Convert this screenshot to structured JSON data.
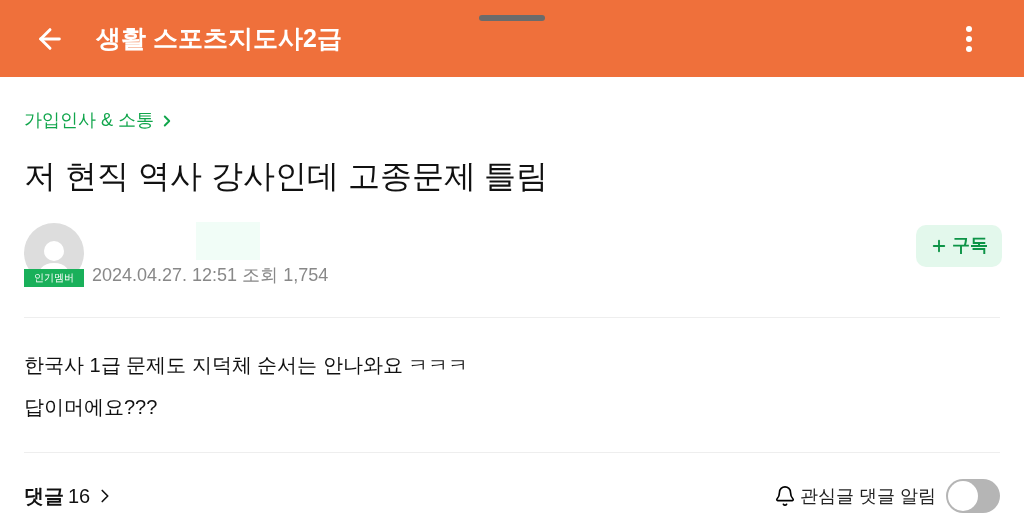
{
  "header": {
    "title": "생활 스포츠지도사2급"
  },
  "post": {
    "board": "가입인사 & 소통",
    "title": "저 현직 역사 강사인데 고종문제 틀림",
    "author": {
      "badge": "인기멤버",
      "meta": "2024.04.27. 12:51 조회 1,754"
    },
    "subscribe": {
      "label": "구독"
    },
    "body": [
      "한국사 1급 문제도 지덕체 순서는 안나와요 ㅋㅋㅋ",
      "답이머에요???"
    ]
  },
  "footer": {
    "comments_label": "댓글",
    "comments_count": "16",
    "notify_label": "관심글 댓글 알림",
    "notify_on": false
  }
}
